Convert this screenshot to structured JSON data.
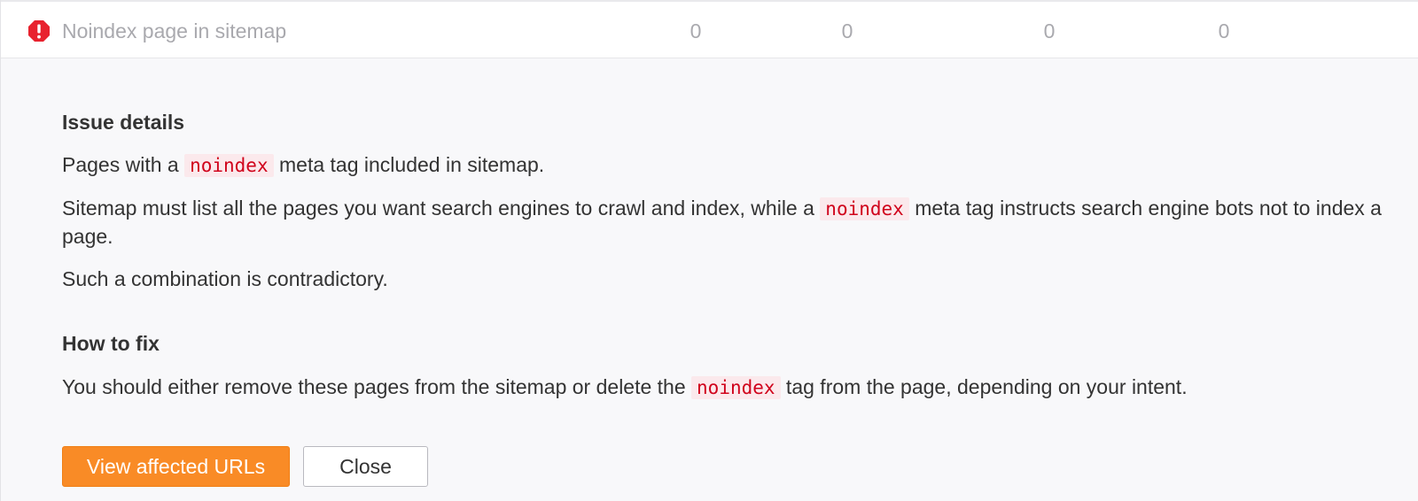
{
  "issue_row": {
    "icon": "error-exclamation-icon",
    "name": "Noindex page in sitemap",
    "counts": [
      "0",
      "0",
      "0",
      "0"
    ]
  },
  "details": {
    "issue_heading": "Issue details",
    "p1": {
      "before": "Pages with a ",
      "code": "noindex",
      "after": " meta tag included in sitemap."
    },
    "p2": {
      "before": "Sitemap must list all the pages you want search engines to crawl and index, while a ",
      "code": "noindex",
      "after": " meta tag instructs search engine bots not to index a page."
    },
    "p3": "Such a combination is contradictory.",
    "fix_heading": "How to fix",
    "p4": {
      "before": "You should either remove these pages from the sitemap or delete the ",
      "code": "noindex",
      "after": " tag from the page, depending on your intent."
    }
  },
  "actions": {
    "view_label": "View affected URLs",
    "close_label": "Close"
  },
  "colors": {
    "error": "#e8232f",
    "primary_button": "#f98b26",
    "code_text": "#d0021b",
    "code_bg": "#fbe9ec",
    "details_bg": "#f8f8fa"
  }
}
